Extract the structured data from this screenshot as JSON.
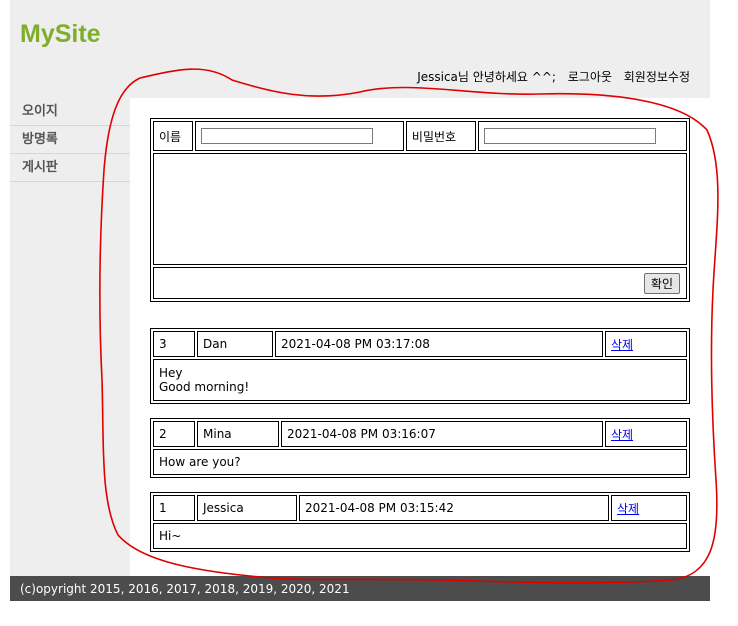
{
  "site": {
    "logo": "MySite"
  },
  "user_nav": {
    "greeting": "Jessica님 안녕하세요 ^^;",
    "logout": "로그아웃",
    "edit_profile": "회원정보수정"
  },
  "sidebar": {
    "items": [
      {
        "label": "오이지"
      },
      {
        "label": "방명록"
      },
      {
        "label": "게시판"
      }
    ]
  },
  "form": {
    "name_label": "이름",
    "name_value": "",
    "password_label": "비밀번호",
    "password_value": "",
    "content_value": "",
    "submit_label": "확인"
  },
  "entries": [
    {
      "no": "3",
      "name": "Dan",
      "date": "2021-04-08 PM 03:17:08",
      "delete_label": "삭제",
      "content_lines": [
        "Hey",
        "Good morning!"
      ]
    },
    {
      "no": "2",
      "name": "Mina",
      "date": "2021-04-08 PM 03:16:07",
      "delete_label": "삭제",
      "content_lines": [
        "How are you?"
      ]
    },
    {
      "no": "1",
      "name": "Jessica",
      "date": "2021-04-08 PM 03:15:42",
      "delete_label": "삭제",
      "content_lines": [
        "Hi~"
      ]
    }
  ],
  "footer": {
    "copyright": "(c)opyright 2015, 2016, 2017, 2018, 2019, 2020, 2021"
  },
  "colors": {
    "logo": "#7fae2d",
    "annotation": "#e00000",
    "footer_bg": "#4c4c4c",
    "panel_bg": "#eeeeee"
  }
}
